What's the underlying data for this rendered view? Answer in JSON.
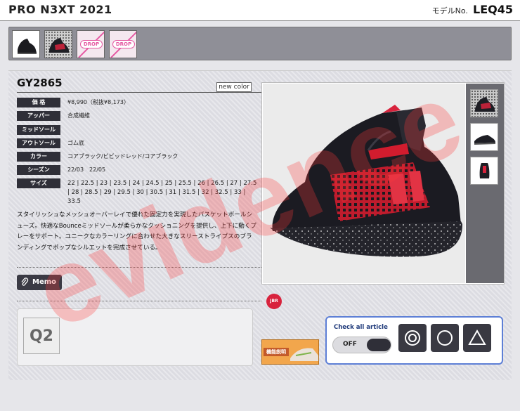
{
  "header": {
    "series_title": "PRO N3XT 2021",
    "model_label": "モデルNo.",
    "model_value": "LEQ45"
  },
  "thumbnails": [
    {
      "icon": "shoe-black-icon"
    },
    {
      "icon": "shoe-red-dots-icon"
    },
    {
      "icon": "drop-icon",
      "badge": "DROP"
    },
    {
      "icon": "drop-icon",
      "badge": "DROP"
    }
  ],
  "product": {
    "code": "GY2865",
    "new_color_label": "new color",
    "specs": {
      "price_label": "価 格",
      "price_value": "¥8,990（税抜¥8,173）",
      "upper_label": "アッパー",
      "upper_value": "合成繊維",
      "midsole_label": "ミッドソール",
      "midsole_value": "",
      "outsole_label": "アウトソール",
      "outsole_value": "ゴム底",
      "color_label": "カラー",
      "color_value": "コアブラック/ビビッドレッド/コアブラック",
      "season_label": "シーズン",
      "season_value": "22/03　22/05",
      "size_label": "サイズ",
      "size_value": "22 | 22.5 | 23 | 23.5 | 24 | 24.5 | 25 | 25.5 | 26 | 26.5 | 27 | 27.5 | 28 | 28.5 | 29 | 29.5 | 30 | 30.5 | 31 | 31.5 | 32 | 32.5 | 33 | 33.5"
    },
    "description": "スタイリッシュなメッシュオーバーレイで優れた固定力を実現したバスケットボールシューズ。快適なBounceミッドソールが柔らかなクッショニングを提供し、上下に動くプレーをサポート。ユニークなカラーリングに合わせた大きなスリーストライプスのブランディングでポップなシルエットを完成させている。",
    "memo_label": "Memo",
    "q_label": "Q2"
  },
  "badges": {
    "jbr": "JBR",
    "spec_guide": "機能説明"
  },
  "check_panel": {
    "label": "Check all article",
    "toggle_label": "OFF",
    "marks": [
      "double-circle-icon",
      "circle-icon",
      "triangle-icon"
    ]
  },
  "watermark": "evidence",
  "colors": {
    "dark_label": "#2f2f38",
    "accent_blue": "#5d7fd6",
    "drop_pink": "#e55aa3",
    "watermark_red": "#ff3b3b"
  }
}
